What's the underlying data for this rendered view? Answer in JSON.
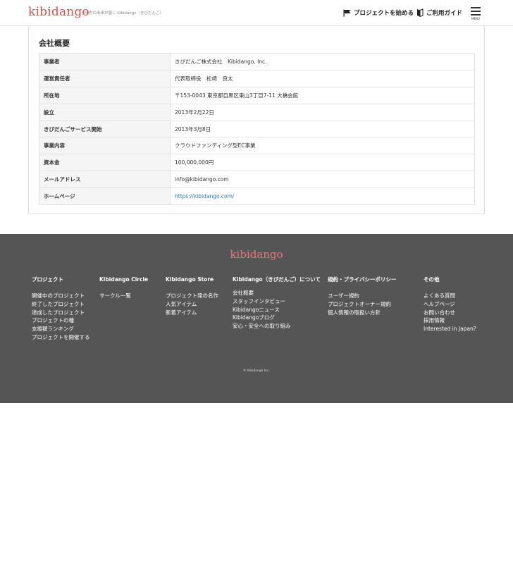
{
  "header": {
    "logo": "kibidango",
    "tagline": "半歩先の未来が届く Kibidango（きびだんご）",
    "start_project": "プロジェクトを始める",
    "guide": "ご利用ガイド",
    "menu": "MENU"
  },
  "company": {
    "title": "会社概要",
    "rows": [
      {
        "key": "事業者",
        "value": "きびだんご株式会社　Kibidango, Inc."
      },
      {
        "key": "運営責任者",
        "value": "代表取締役　松崎　良太"
      },
      {
        "key": "所在地",
        "value": "〒153-0043 東京都目黒区東山3丁目7-11 大橋会館"
      },
      {
        "key": "設立",
        "value": "2013年2月22日"
      },
      {
        "key": "きびだんごサービス開始",
        "value": "2013年3月8日"
      },
      {
        "key": "事業内容",
        "value": "クラウドファンディング型EC事業"
      },
      {
        "key": "資本金",
        "value": "100,000,000円"
      },
      {
        "key": "メールアドレス",
        "value": "info@kibidango.com"
      },
      {
        "key": "ホームページ",
        "value": "https://kibidango.com/"
      }
    ]
  },
  "footer": {
    "logo": "kibidango",
    "columns": [
      {
        "heading": "プロジェクト",
        "items": [
          "開催中のプロジェクト",
          "終了したプロジェクト",
          "達成したプロジェクト",
          "プロジェクトの種",
          "支援額ランキング",
          "プロジェクトを開催する"
        ]
      },
      {
        "heading": "Kibidango Circle",
        "items": [
          "サークル一覧"
        ]
      },
      {
        "heading": "Kibidango Store",
        "items": [
          "プロジェクト発の名作",
          "人気アイテム",
          "新着アイテム"
        ]
      },
      {
        "heading": "Kibidango（きびだんご）について",
        "items": [
          "会社概要",
          "スタッフインタビュー",
          "Kibidangoニュース",
          "Kibidangoブログ",
          "安心・安全への取り組み"
        ]
      },
      {
        "heading": "規約・プライバシーポリシー",
        "items": [
          "ユーザー規約",
          "プロジェクトオーナー規約",
          "個人情報の取扱い方針"
        ]
      },
      {
        "heading": "その他",
        "items": [
          "よくある質問",
          "ヘルプページ",
          "お問い合わせ",
          "採用情報",
          "Interested in Japan?"
        ]
      }
    ],
    "copyright": "© Kibidango Inc."
  }
}
